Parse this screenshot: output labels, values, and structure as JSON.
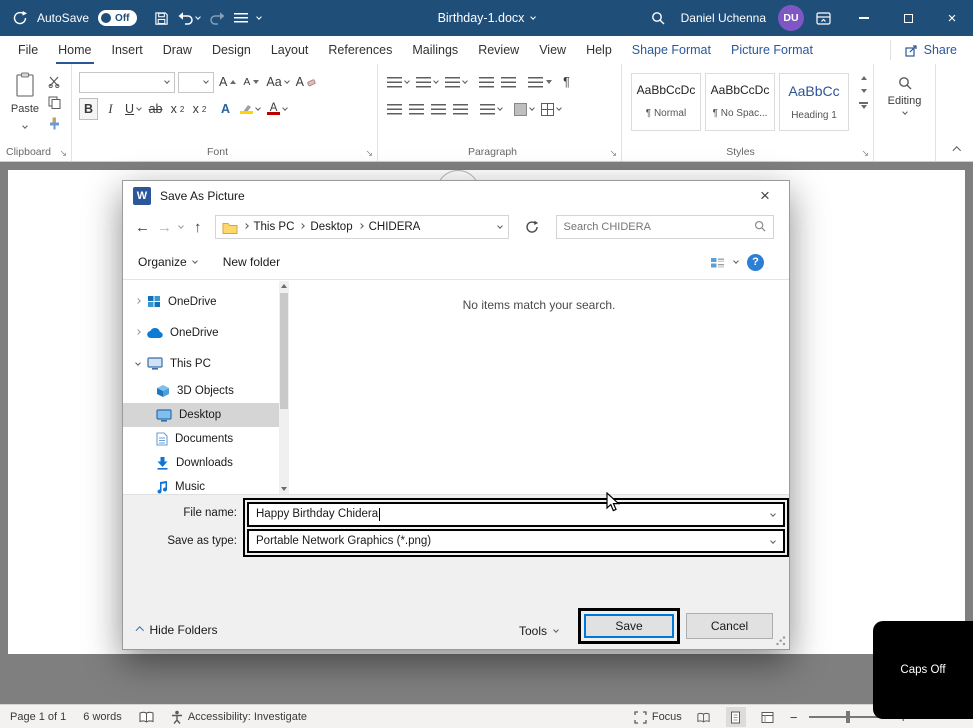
{
  "colors": {
    "titlebar": "#1f4e79",
    "accent": "#2b579a",
    "avatar": "#7e57c5",
    "save_button_border": "#0078d7",
    "selection_gray": "#d5d5d5"
  },
  "icons": {
    "close": "×",
    "back": "←",
    "forward": "→",
    "up": "↑",
    "pilcrow": "¶",
    "launcher": "↘",
    "minus": "−",
    "plus": "+",
    "help": "?"
  },
  "titlebar": {
    "autosave_label": "AutoSave",
    "autosave_state": "Off",
    "doc_title": "Birthday-1.docx",
    "user_name": "Daniel Uchenna",
    "user_initials": "DU"
  },
  "menubar": {
    "tabs": [
      {
        "label": "File"
      },
      {
        "label": "Home"
      },
      {
        "label": "Insert"
      },
      {
        "label": "Draw"
      },
      {
        "label": "Design"
      },
      {
        "label": "Layout"
      },
      {
        "label": "References"
      },
      {
        "label": "Mailings"
      },
      {
        "label": "Review"
      },
      {
        "label": "View"
      },
      {
        "label": "Help"
      },
      {
        "label": "Shape Format"
      },
      {
        "label": "Picture Format"
      }
    ],
    "active_tab": "Home",
    "share_label": "Share"
  },
  "ribbon": {
    "clipboard": {
      "label": "Clipboard",
      "paste_label": "Paste"
    },
    "font": {
      "label": "Font",
      "bold": "B",
      "italic": "I",
      "underline": "U",
      "strikethrough": "ab",
      "subscript_base": "x",
      "subscript_small": "2",
      "superscript_base": "x",
      "superscript_small": "2",
      "effects": "A",
      "case": "Aa",
      "grow": "A",
      "shrink": "A",
      "clear": "A",
      "color": "A"
    },
    "paragraph": {
      "label": "Paragraph"
    },
    "styles": {
      "label": "Styles",
      "items": [
        {
          "preview": "AaBbCcDc",
          "name": "¶ Normal"
        },
        {
          "preview": "AaBbCcDc",
          "name": "¶ No Spac..."
        },
        {
          "preview": "AaBbCc",
          "name": "Heading 1"
        }
      ]
    },
    "editing": {
      "label": "Editing"
    }
  },
  "dialog": {
    "title": "Save As Picture",
    "logo_letter": "W",
    "breadcrumb": {
      "items": [
        "This PC",
        "Desktop",
        "CHIDERA"
      ]
    },
    "search_placeholder": "Search CHIDERA",
    "commandbar": {
      "organize": "Organize",
      "new_folder": "New folder"
    },
    "sidebar": {
      "items": [
        {
          "label": "OneDrive"
        },
        {
          "label": "OneDrive"
        },
        {
          "label": "This PC"
        },
        {
          "label": "3D Objects"
        },
        {
          "label": "Desktop",
          "selected": true
        },
        {
          "label": "Documents"
        },
        {
          "label": "Downloads"
        },
        {
          "label": "Music"
        }
      ]
    },
    "empty_message": "No items match your search.",
    "fields": {
      "file_name_label": "File name:",
      "file_name_value": "Happy Birthday Chidera",
      "save_as_type_label": "Save as type:",
      "save_as_type_value": "Portable Network Graphics (*.png)"
    },
    "footer": {
      "hide_folders": "Hide Folders",
      "tools": "Tools",
      "save": "Save",
      "cancel": "Cancel"
    }
  },
  "statusbar": {
    "page": "Page 1 of 1",
    "words": "6 words",
    "accessibility": "Accessibility: Investigate",
    "focus": "Focus"
  },
  "overlay": {
    "caps_label": "Caps Off"
  }
}
